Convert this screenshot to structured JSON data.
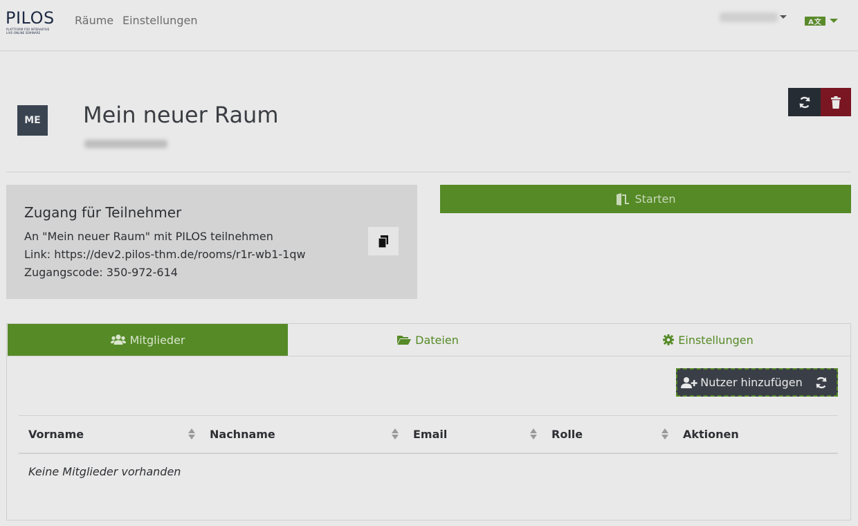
{
  "navbar": {
    "logo_text": "PILOS",
    "logo_subtitle_1": "PLATTFORM FÜR INTERAKTIVE",
    "logo_subtitle_2": "LIVE-ONLINE SEMINARE",
    "links": [
      {
        "label": "Räume"
      },
      {
        "label": "Einstellungen"
      }
    ],
    "language_badge": "A文"
  },
  "room": {
    "avatar_initials": "ME",
    "title": "Mein neuer Raum"
  },
  "access": {
    "title": "Zugang für Teilnehmer",
    "line1": "An \"Mein neuer Raum\" mit PILOS teilnehmen",
    "line2": "Link: https://dev2.pilos-thm.de/rooms/r1r-wb1-1qw",
    "line3": "Zugangscode: 350-972-614"
  },
  "start_button": {
    "label": "Starten"
  },
  "tabs": [
    {
      "label": "Mitglieder",
      "icon": "users-icon",
      "active": true
    },
    {
      "label": "Dateien",
      "icon": "folder-open-icon",
      "active": false
    },
    {
      "label": "Einstellungen",
      "icon": "cog-icon",
      "active": false
    }
  ],
  "members": {
    "add_user_label": "Nutzer hinzufügen",
    "columns": [
      "Vorname",
      "Nachname",
      "Email",
      "Rolle",
      "Aktionen"
    ],
    "empty_message": "Keine Mitglieder vorhanden"
  },
  "colors": {
    "primary_green": "#558a26",
    "dark": "#262c33",
    "danger": "#7a1522"
  }
}
